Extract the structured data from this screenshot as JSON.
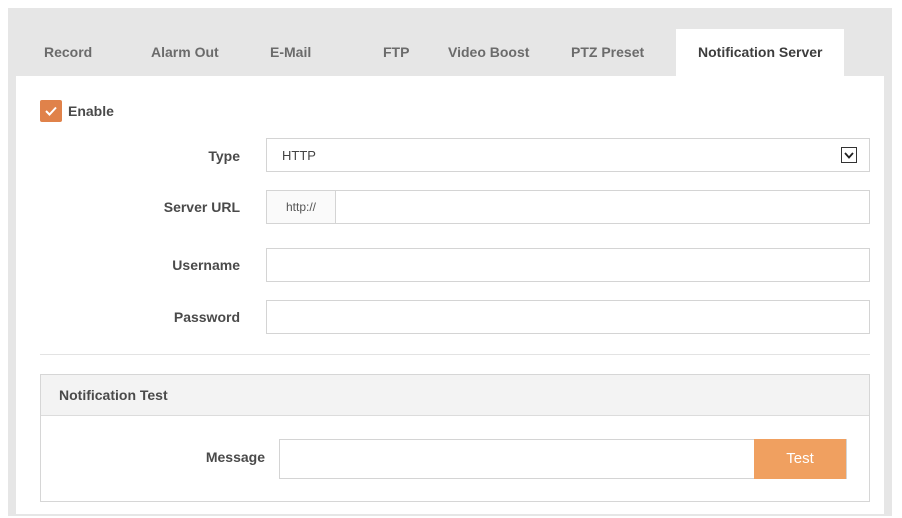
{
  "tabs": [
    {
      "label": "Record"
    },
    {
      "label": "Alarm Out"
    },
    {
      "label": "E-Mail"
    },
    {
      "label": "FTP"
    },
    {
      "label": "Video Boost"
    },
    {
      "label": "PTZ Preset"
    },
    {
      "label": "Notification Server",
      "active": true
    }
  ],
  "form": {
    "enable_label": "Enable",
    "enable_checked": true,
    "type_label": "Type",
    "type_value": "HTTP",
    "server_url_label": "Server URL",
    "server_url_prefix": "http://",
    "server_url_value": "",
    "username_label": "Username",
    "username_value": "",
    "password_label": "Password",
    "password_value": ""
  },
  "test": {
    "title": "Notification Test",
    "message_label": "Message",
    "message_value": "",
    "button_label": "Test"
  },
  "colors": {
    "accent": "#e0824a",
    "button": "#f0a060",
    "frame": "#e6e6e6"
  }
}
